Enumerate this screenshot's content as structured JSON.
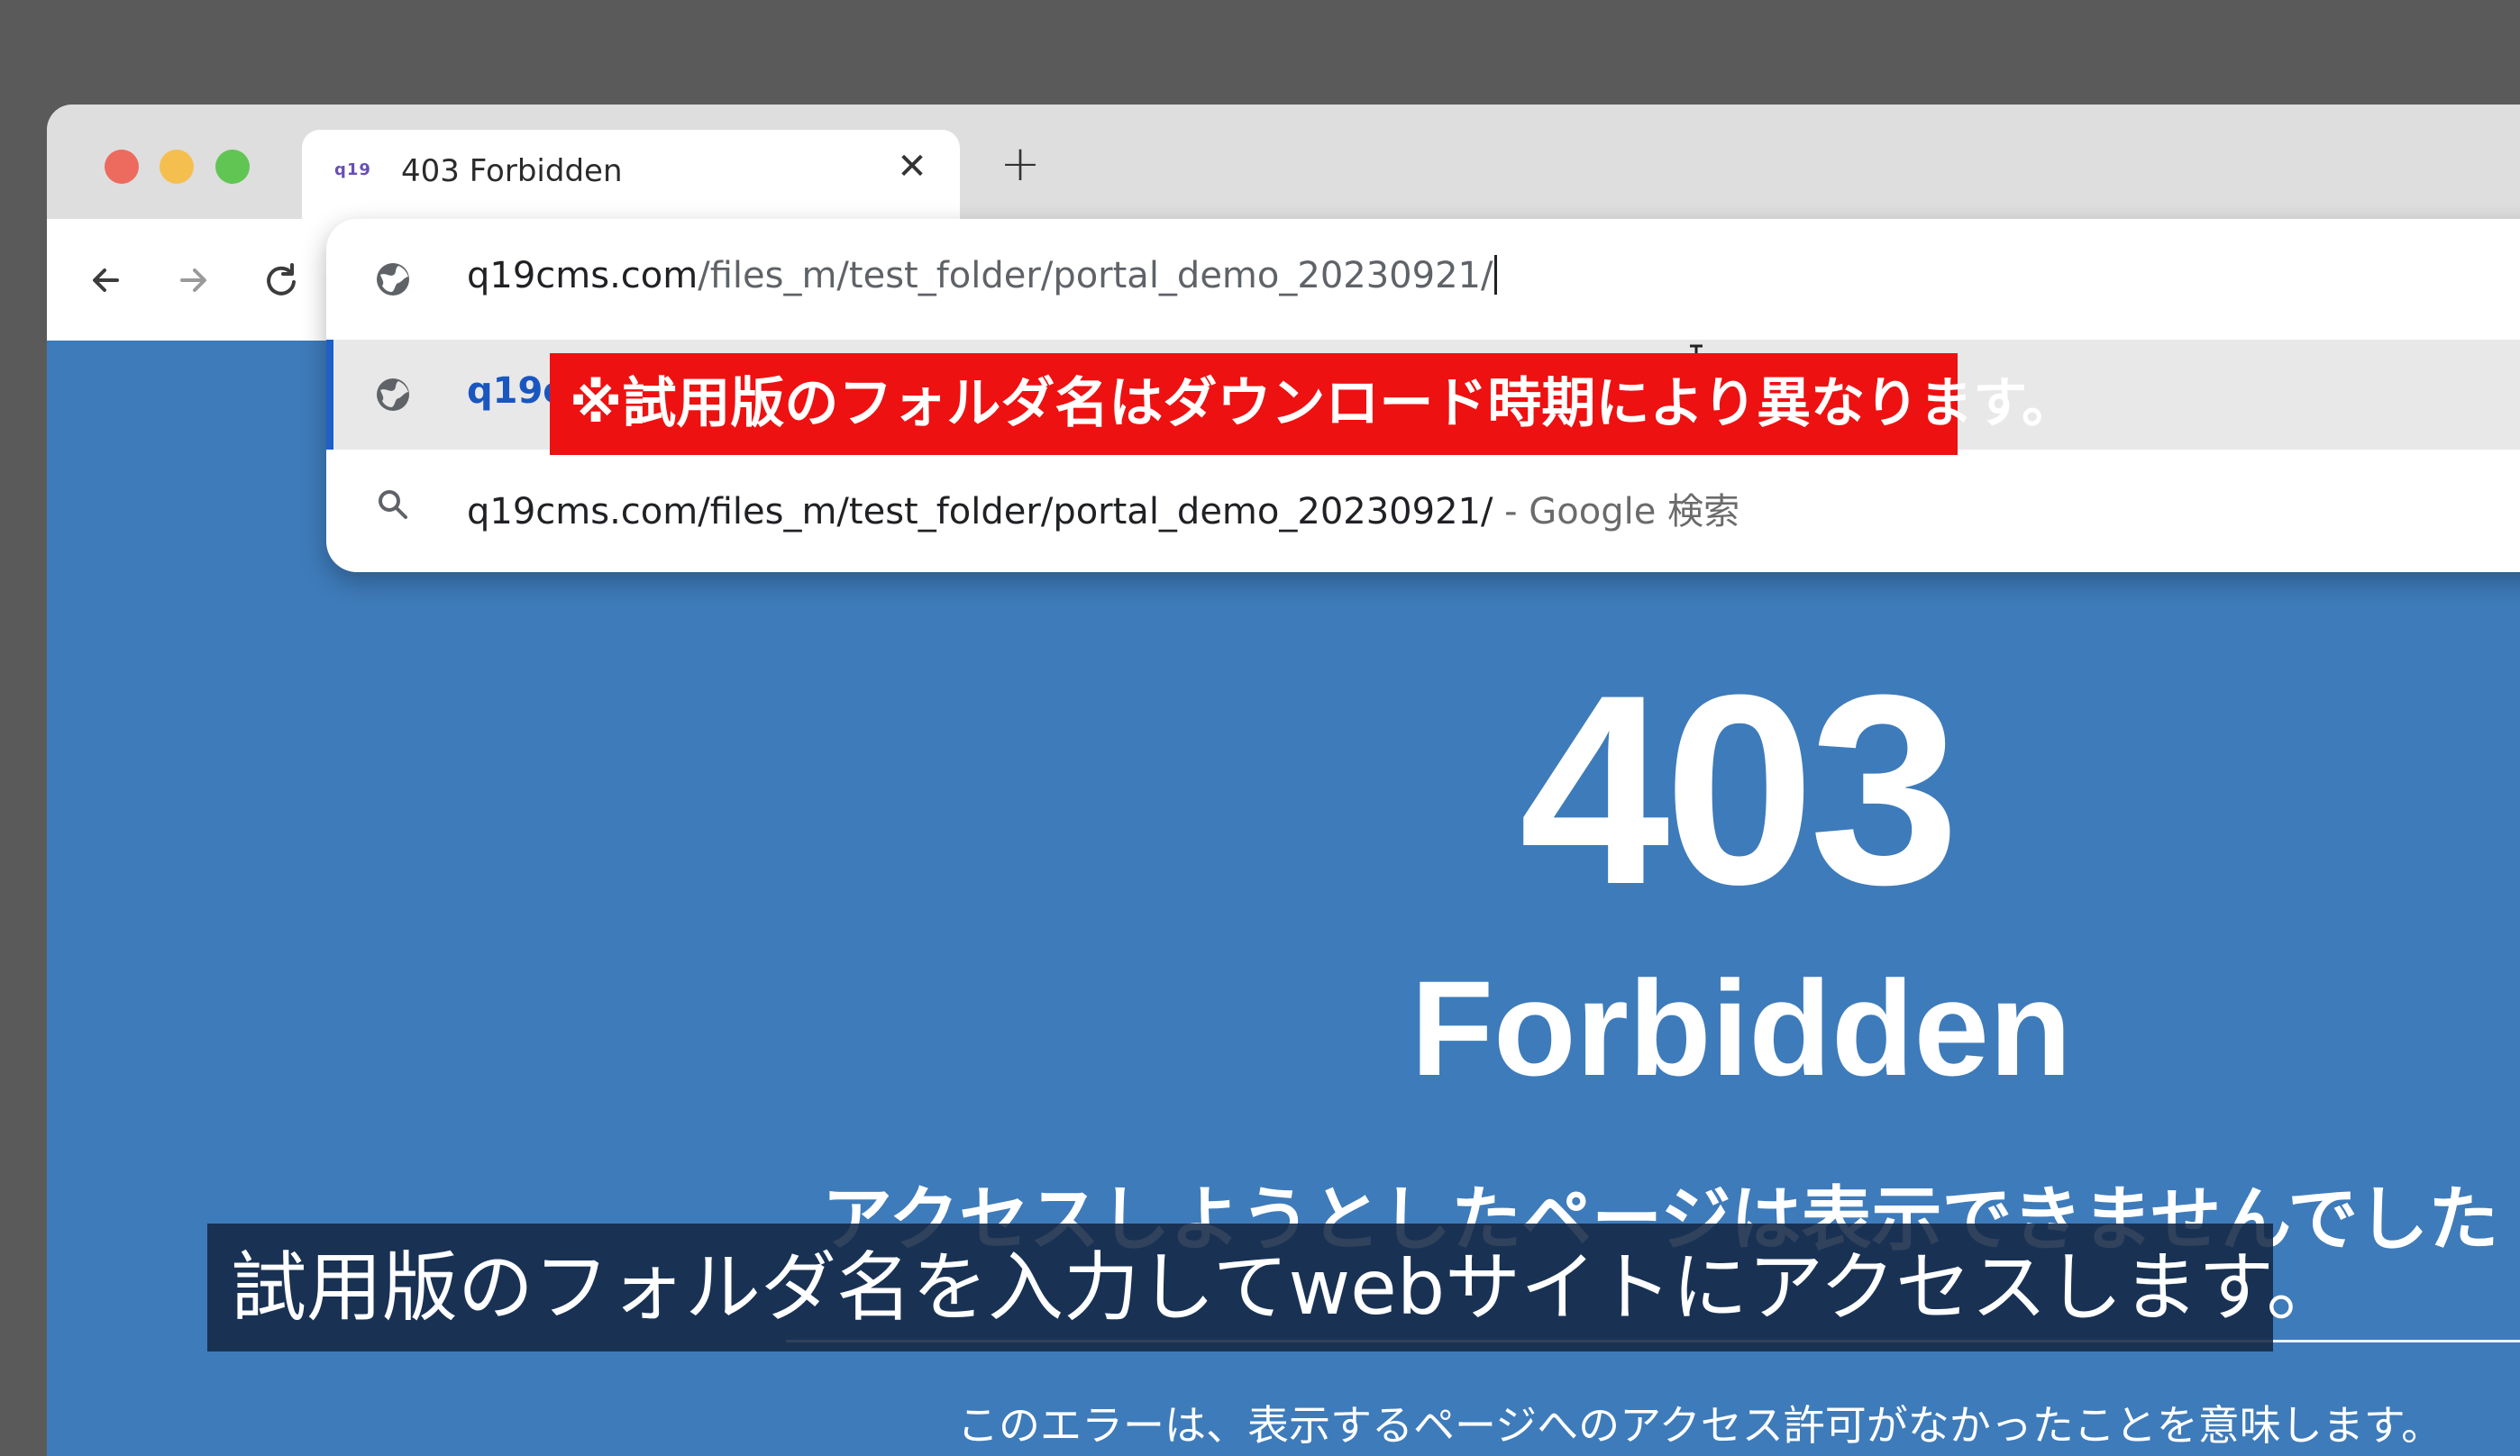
{
  "tab": {
    "favicon": "q19",
    "title": "403 Forbidden",
    "close_glyph": "✕"
  },
  "new_tab_glyph": "+",
  "nav": {
    "back": "back-icon",
    "forward": "forward-icon",
    "reload": "reload-icon"
  },
  "omnibox": {
    "input_host": "q19cms.com",
    "input_path": "/files_m/test_folder/portal_demo_20230921/",
    "suggestion1_text": "q19c",
    "suggestion2_text": "q19cms.com/files_m/test_folder/portal_demo_20230921/",
    "suggestion2_suffix": " - Google 検索"
  },
  "note": "※試用版のフォルダ名はダウンロード時期により異なります。",
  "page": {
    "code": "403",
    "status": "Forbidden",
    "message": "アクセスしようとしたページは表示できませんでした",
    "description": "このエラーは、表示するページへのアクセス許可がなかったことを意味します。"
  },
  "subtitle": "試用版のフォルダ名を入力してwebサイトにアクセスします。",
  "colors": {
    "page_bg": "#3e7bba",
    "note_bg": "#ee1111",
    "suggest_accent": "#1f5fc8"
  }
}
